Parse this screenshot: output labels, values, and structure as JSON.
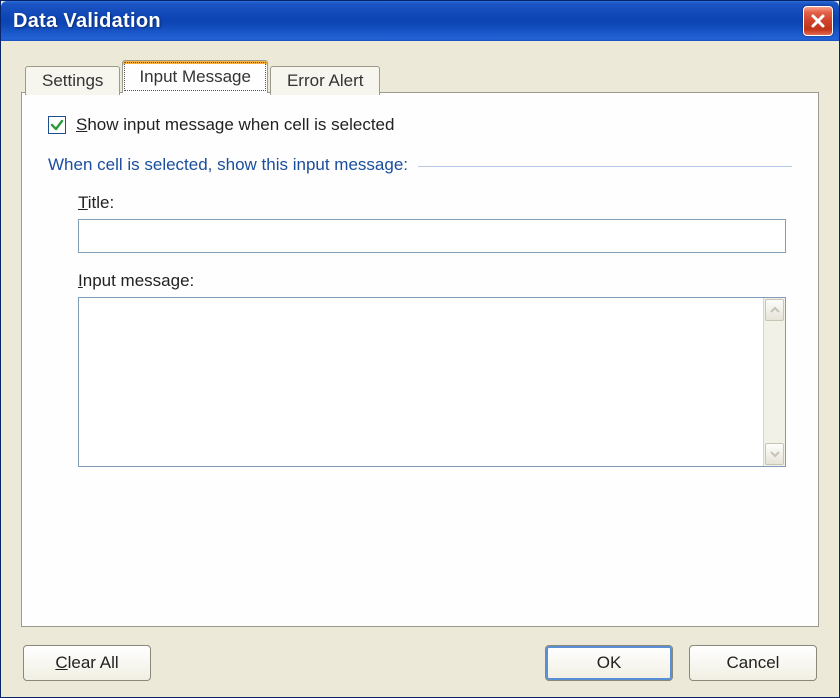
{
  "titlebar": {
    "title": "Data Validation"
  },
  "tabs": {
    "settings": "Settings",
    "input_message": "Input Message",
    "error_alert": "Error Alert"
  },
  "panel": {
    "checkbox_prefix": "S",
    "checkbox_rest": "how input message when cell is selected",
    "section_head": "When cell is selected, show this input message:",
    "title_prefix": "T",
    "title_rest": "itle:",
    "title_value": "",
    "msg_prefix": "I",
    "msg_rest": "nput message:",
    "msg_value": ""
  },
  "buttons": {
    "clear_prefix": "C",
    "clear_rest": "lear All",
    "ok": "OK",
    "cancel": "Cancel"
  }
}
